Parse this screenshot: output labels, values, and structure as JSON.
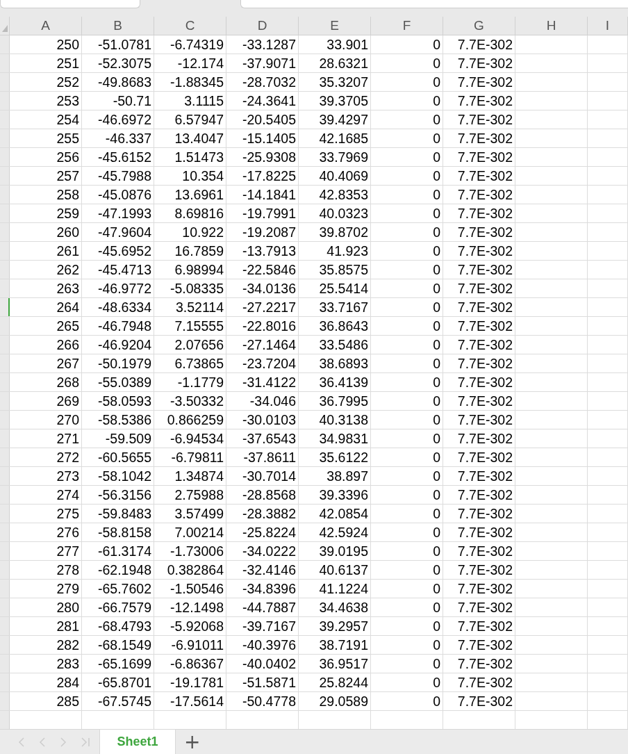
{
  "columns": [
    "A",
    "B",
    "C",
    "D",
    "E",
    "F",
    "G",
    "H",
    "I"
  ],
  "rows": [
    {
      "selected": false,
      "cells": [
        "250",
        "-51.0781",
        "-6.74319",
        "-33.1287",
        "33.901",
        "0",
        "7.7E-302"
      ]
    },
    {
      "selected": false,
      "cells": [
        "251",
        "-52.3075",
        "-12.174",
        "-37.9071",
        "28.6321",
        "0",
        "7.7E-302"
      ]
    },
    {
      "selected": false,
      "cells": [
        "252",
        "-49.8683",
        "-1.88345",
        "-28.7032",
        "35.3207",
        "0",
        "7.7E-302"
      ]
    },
    {
      "selected": false,
      "cells": [
        "253",
        "-50.71",
        "3.1115",
        "-24.3641",
        "39.3705",
        "0",
        "7.7E-302"
      ]
    },
    {
      "selected": false,
      "cells": [
        "254",
        "-46.6972",
        "6.57947",
        "-20.5405",
        "39.4297",
        "0",
        "7.7E-302"
      ]
    },
    {
      "selected": false,
      "cells": [
        "255",
        "-46.337",
        "13.4047",
        "-15.1405",
        "42.1685",
        "0",
        "7.7E-302"
      ]
    },
    {
      "selected": false,
      "cells": [
        "256",
        "-45.6152",
        "1.51473",
        "-25.9308",
        "33.7969",
        "0",
        "7.7E-302"
      ]
    },
    {
      "selected": false,
      "cells": [
        "257",
        "-45.7988",
        "10.354",
        "-17.8225",
        "40.4069",
        "0",
        "7.7E-302"
      ]
    },
    {
      "selected": false,
      "cells": [
        "258",
        "-45.0876",
        "13.6961",
        "-14.1841",
        "42.8353",
        "0",
        "7.7E-302"
      ]
    },
    {
      "selected": false,
      "cells": [
        "259",
        "-47.1993",
        "8.69816",
        "-19.7991",
        "40.0323",
        "0",
        "7.7E-302"
      ]
    },
    {
      "selected": false,
      "cells": [
        "260",
        "-47.9604",
        "10.922",
        "-19.2087",
        "39.8702",
        "0",
        "7.7E-302"
      ]
    },
    {
      "selected": false,
      "cells": [
        "261",
        "-45.6952",
        "16.7859",
        "-13.7913",
        "41.923",
        "0",
        "7.7E-302"
      ]
    },
    {
      "selected": false,
      "cells": [
        "262",
        "-45.4713",
        "6.98994",
        "-22.5846",
        "35.8575",
        "0",
        "7.7E-302"
      ]
    },
    {
      "selected": false,
      "cells": [
        "263",
        "-46.9772",
        "-5.08335",
        "-34.0136",
        "25.5414",
        "0",
        "7.7E-302"
      ]
    },
    {
      "selected": true,
      "cells": [
        "264",
        "-48.6334",
        "3.52114",
        "-27.2217",
        "33.7167",
        "0",
        "7.7E-302"
      ]
    },
    {
      "selected": false,
      "cells": [
        "265",
        "-46.7948",
        "7.15555",
        "-22.8016",
        "36.8643",
        "0",
        "7.7E-302"
      ]
    },
    {
      "selected": false,
      "cells": [
        "266",
        "-46.9204",
        "2.07656",
        "-27.1464",
        "33.5486",
        "0",
        "7.7E-302"
      ]
    },
    {
      "selected": false,
      "cells": [
        "267",
        "-50.1979",
        "6.73865",
        "-23.7204",
        "38.6893",
        "0",
        "7.7E-302"
      ]
    },
    {
      "selected": false,
      "cells": [
        "268",
        "-55.0389",
        "-1.1779",
        "-31.4122",
        "36.4139",
        "0",
        "7.7E-302"
      ]
    },
    {
      "selected": false,
      "cells": [
        "269",
        "-58.0593",
        "-3.50332",
        "-34.046",
        "36.7995",
        "0",
        "7.7E-302"
      ]
    },
    {
      "selected": false,
      "cells": [
        "270",
        "-58.5386",
        "0.866259",
        "-30.0103",
        "40.3138",
        "0",
        "7.7E-302"
      ]
    },
    {
      "selected": false,
      "cells": [
        "271",
        "-59.509",
        "-6.94534",
        "-37.6543",
        "34.9831",
        "0",
        "7.7E-302"
      ]
    },
    {
      "selected": false,
      "cells": [
        "272",
        "-60.5655",
        "-6.79811",
        "-37.8611",
        "35.6122",
        "0",
        "7.7E-302"
      ]
    },
    {
      "selected": false,
      "cells": [
        "273",
        "-58.1042",
        "1.34874",
        "-30.7014",
        "38.897",
        "0",
        "7.7E-302"
      ]
    },
    {
      "selected": false,
      "cells": [
        "274",
        "-56.3156",
        "2.75988",
        "-28.8568",
        "39.3396",
        "0",
        "7.7E-302"
      ]
    },
    {
      "selected": false,
      "cells": [
        "275",
        "-59.8483",
        "3.57499",
        "-28.3882",
        "42.0854",
        "0",
        "7.7E-302"
      ]
    },
    {
      "selected": false,
      "cells": [
        "276",
        "-58.8158",
        "7.00214",
        "-25.8224",
        "42.5924",
        "0",
        "7.7E-302"
      ]
    },
    {
      "selected": false,
      "cells": [
        "277",
        "-61.3174",
        "-1.73006",
        "-34.0222",
        "39.0195",
        "0",
        "7.7E-302"
      ]
    },
    {
      "selected": false,
      "cells": [
        "278",
        "-62.1948",
        "0.382864",
        "-32.4146",
        "40.6137",
        "0",
        "7.7E-302"
      ]
    },
    {
      "selected": false,
      "cells": [
        "279",
        "-65.7602",
        "-1.50546",
        "-34.8396",
        "41.1224",
        "0",
        "7.7E-302"
      ]
    },
    {
      "selected": false,
      "cells": [
        "280",
        "-66.7579",
        "-12.1498",
        "-44.7887",
        "34.4638",
        "0",
        "7.7E-302"
      ]
    },
    {
      "selected": false,
      "cells": [
        "281",
        "-68.4793",
        "-5.92068",
        "-39.7167",
        "39.2957",
        "0",
        "7.7E-302"
      ]
    },
    {
      "selected": false,
      "cells": [
        "282",
        "-68.1549",
        "-6.91011",
        "-40.3976",
        "38.7191",
        "0",
        "7.7E-302"
      ]
    },
    {
      "selected": false,
      "cells": [
        "283",
        "-65.1699",
        "-6.86367",
        "-40.0402",
        "36.9517",
        "0",
        "7.7E-302"
      ]
    },
    {
      "selected": false,
      "cells": [
        "284",
        "-65.8701",
        "-19.1781",
        "-51.5871",
        "25.8244",
        "0",
        "7.7E-302"
      ]
    },
    {
      "selected": false,
      "cells": [
        "285",
        "-67.5745",
        "-17.5614",
        "-50.4778",
        "29.0589",
        "0",
        "7.7E-302"
      ]
    }
  ],
  "sheet_tabs": [
    {
      "label": "Sheet1",
      "selected": true
    }
  ],
  "add_sheet": "+"
}
